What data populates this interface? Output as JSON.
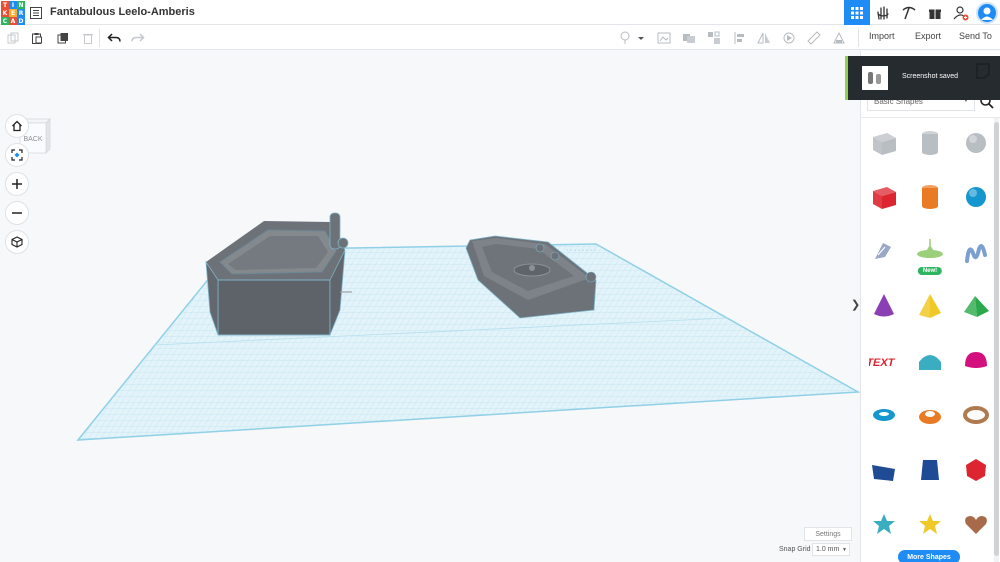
{
  "app": {
    "logo_letters": [
      "T",
      "I",
      "N",
      "K",
      "E",
      "R",
      "C",
      "A",
      "D"
    ],
    "logo_colors": [
      "#e94f35",
      "#1f8bf5",
      "#2fb561",
      "#e94f35",
      "#f3b12f",
      "#1f8bf5",
      "#2fb561",
      "#e94f35",
      "#1f8bf5"
    ],
    "document_title": "Fantabulous Leelo-Amberis"
  },
  "topbar": {
    "icons": [
      "grid-view-icon",
      "hand-wave-icon",
      "pickaxe-icon",
      "gift-icon",
      "add-user-icon",
      "avatar"
    ]
  },
  "toolbar": {
    "left_icons": [
      "copy-icon",
      "paste-icon",
      "duplicate-icon",
      "delete-icon",
      "undo-icon",
      "redo-icon"
    ],
    "right_icons": [
      "light-bulb-icon",
      "group-icon",
      "ungroup-icon",
      "align-icon",
      "mirror-icon",
      "workplane-icon",
      "ruler-icon",
      "notes-icon"
    ],
    "import_label": "Import",
    "export_label": "Export",
    "sendto_label": "Send To"
  },
  "viewport": {
    "viewcube_label": "BACK",
    "nav_buttons": [
      "home-view",
      "fit-all",
      "zoom-in",
      "zoom-out",
      "perspective"
    ],
    "settings_label": "Settings",
    "snap_grid_label": "Snap Grid",
    "snap_grid_value": "1.0 mm"
  },
  "panel": {
    "category": "Basic Shapes",
    "more_shapes_label": "More Shapes",
    "shapes": [
      {
        "name": "box-hole",
        "color": "#b9bec3",
        "shape": "box",
        "badge": ""
      },
      {
        "name": "cylinder-hole",
        "color": "#b9bec3",
        "shape": "cylinder",
        "badge": ""
      },
      {
        "name": "sphere-hole",
        "color": "#b9bec3",
        "shape": "sphere",
        "badge": ""
      },
      {
        "name": "box",
        "color": "#dd2531",
        "shape": "box",
        "badge": ""
      },
      {
        "name": "cylinder",
        "color": "#e97b24",
        "shape": "cylinder",
        "badge": ""
      },
      {
        "name": "sphere",
        "color": "#1596cf",
        "shape": "sphere",
        "badge": ""
      },
      {
        "name": "scribble",
        "color": "#9aa7c6",
        "shape": "scribble",
        "badge": ""
      },
      {
        "name": "pen-shape",
        "color": "#9ccf7a",
        "shape": "spinner",
        "badge": "New!"
      },
      {
        "name": "text-wave",
        "color": "#7b9fcf",
        "shape": "wave",
        "badge": ""
      },
      {
        "name": "cone",
        "color": "#8a3fb5",
        "shape": "cone",
        "badge": ""
      },
      {
        "name": "pyramid",
        "color": "#f0c928",
        "shape": "pyramid",
        "badge": ""
      },
      {
        "name": "roof",
        "color": "#2aa84a",
        "shape": "roof",
        "badge": ""
      },
      {
        "name": "text",
        "color": "#dd2531",
        "shape": "text",
        "badge": ""
      },
      {
        "name": "half-cylinder",
        "color": "#3aaec0",
        "shape": "half-cylinder",
        "badge": ""
      },
      {
        "name": "half-sphere",
        "color": "#d4107f",
        "shape": "half-sphere",
        "badge": ""
      },
      {
        "name": "torus",
        "color": "#1596cf",
        "shape": "torus",
        "badge": ""
      },
      {
        "name": "tube",
        "color": "#e97b24",
        "shape": "tube",
        "badge": ""
      },
      {
        "name": "ring",
        "color": "#b07a4f",
        "shape": "ring",
        "badge": ""
      },
      {
        "name": "wedge",
        "color": "#1f4a94",
        "shape": "wedge",
        "badge": ""
      },
      {
        "name": "polygon",
        "color": "#1f4a94",
        "shape": "polygon",
        "badge": ""
      },
      {
        "name": "icosahedron",
        "color": "#dd2531",
        "shape": "gem",
        "badge": ""
      },
      {
        "name": "star-teal",
        "color": "#3aaec0",
        "shape": "star",
        "badge": ""
      },
      {
        "name": "star-yellow",
        "color": "#f0c928",
        "shape": "star",
        "badge": ""
      },
      {
        "name": "heart",
        "color": "#a76b4b",
        "shape": "heart",
        "badge": ""
      }
    ]
  },
  "toast": {
    "message": "Screenshot saved"
  }
}
